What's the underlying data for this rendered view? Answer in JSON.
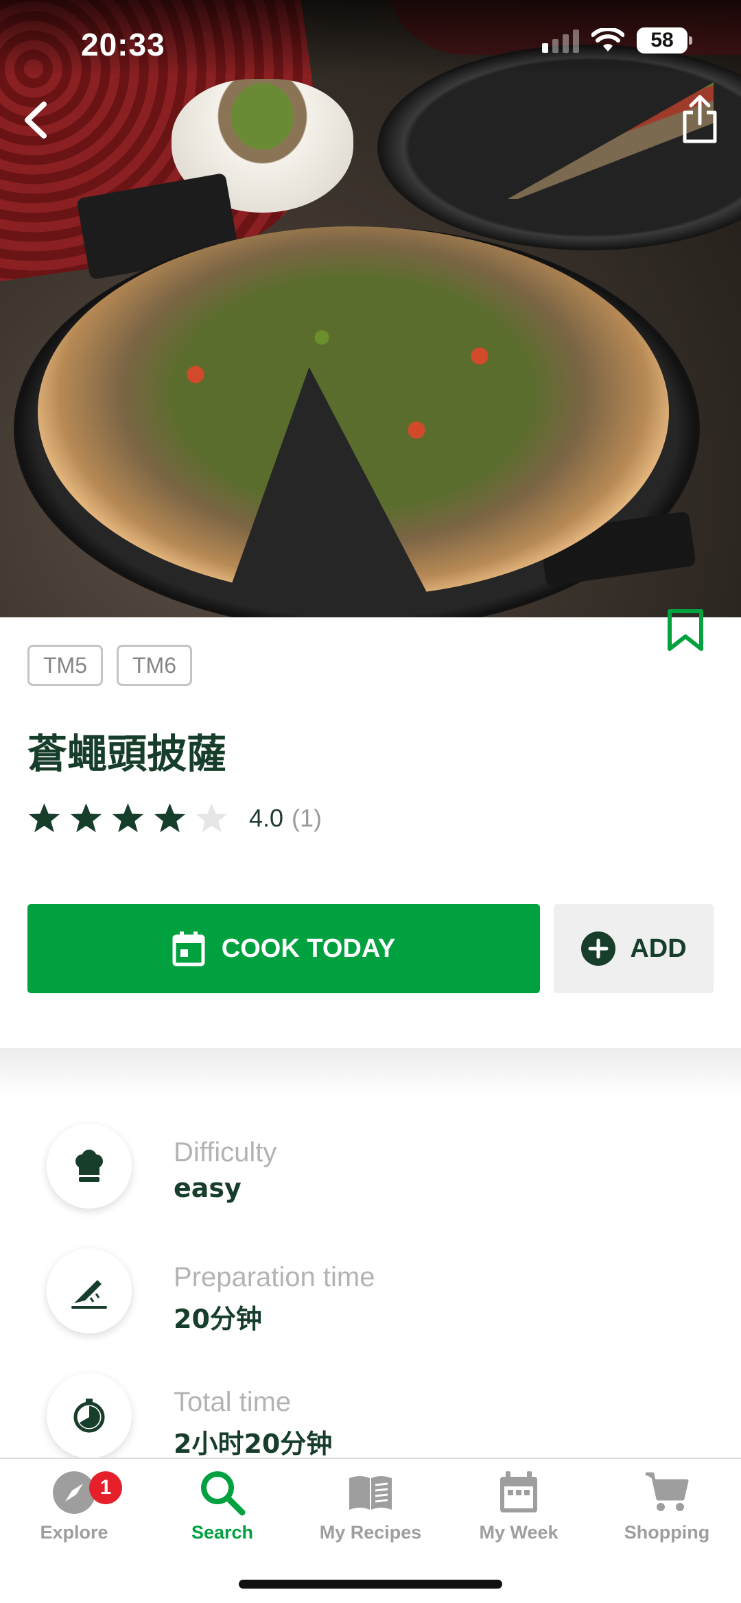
{
  "status_bar": {
    "time": "20:33",
    "battery": "58"
  },
  "recipe": {
    "tags": [
      "TM5",
      "TM6"
    ],
    "title": "蒼蠅頭披薩",
    "rating": {
      "value": "4.0",
      "count": "(1)",
      "stars": 4,
      "max": 5
    }
  },
  "actions": {
    "cook_today": "COOK TODAY",
    "add": "ADD"
  },
  "details": [
    {
      "label": "Difficulty",
      "value": "easy",
      "icon": "chef-hat-icon"
    },
    {
      "label": "Preparation time",
      "value": "20分钟",
      "icon": "knife-icon"
    },
    {
      "label": "Total time",
      "value": "2小时20分钟",
      "icon": "timer-icon"
    }
  ],
  "tabbar": {
    "items": [
      {
        "label": "Explore",
        "icon": "compass-icon",
        "badge": "1"
      },
      {
        "label": "Search",
        "icon": "search-icon",
        "active": true
      },
      {
        "label": "My Recipes",
        "icon": "book-icon"
      },
      {
        "label": "My Week",
        "icon": "calendar-icon"
      },
      {
        "label": "Shopping",
        "icon": "cart-icon"
      }
    ]
  },
  "colors": {
    "primary_green": "#00a13e",
    "dark_green": "#173d2b",
    "badge_red": "#e6202a"
  }
}
